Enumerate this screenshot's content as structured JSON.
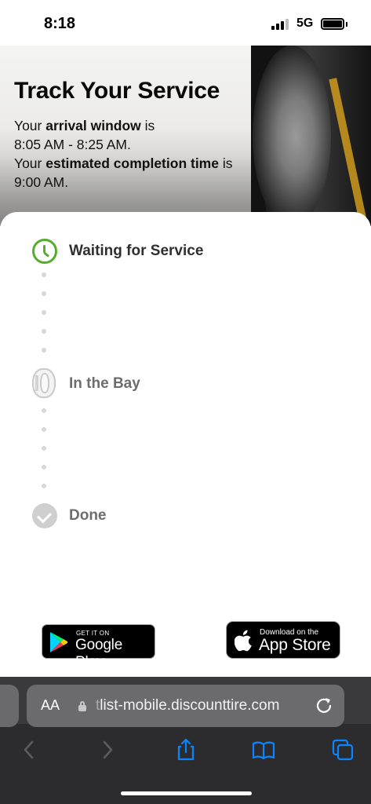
{
  "status_bar": {
    "time": "8:18",
    "network": "5G"
  },
  "hero": {
    "title": "Track Your Service",
    "line1_prefix": "Your ",
    "line1_bold": "arrival window",
    "line1_suffix": " is",
    "line2": "8:05 AM - 8:25 AM.",
    "line3_prefix": "Your ",
    "line3_bold": "estimated completion time",
    "line3_suffix": " is",
    "line4": "9:00 AM."
  },
  "steps": [
    {
      "label": "Waiting for Service",
      "icon": "clock-icon",
      "state": "active",
      "color": "#55ad2c"
    },
    {
      "label": "In the Bay",
      "icon": "tire-icon",
      "state": "pending"
    },
    {
      "label": "Done",
      "icon": "checkmark-icon",
      "state": "pending"
    }
  ],
  "badges": {
    "google_small": "GET IT ON",
    "google_big": "Google Play",
    "apple_small": "Download on the",
    "apple_big": "App Store"
  },
  "browser": {
    "aa_label": "AA",
    "url_faded": "t",
    "url": "list-mobile.discounttire.com"
  },
  "colors": {
    "accent_green": "#55ad2c",
    "ios_blue": "#0a84ff"
  }
}
